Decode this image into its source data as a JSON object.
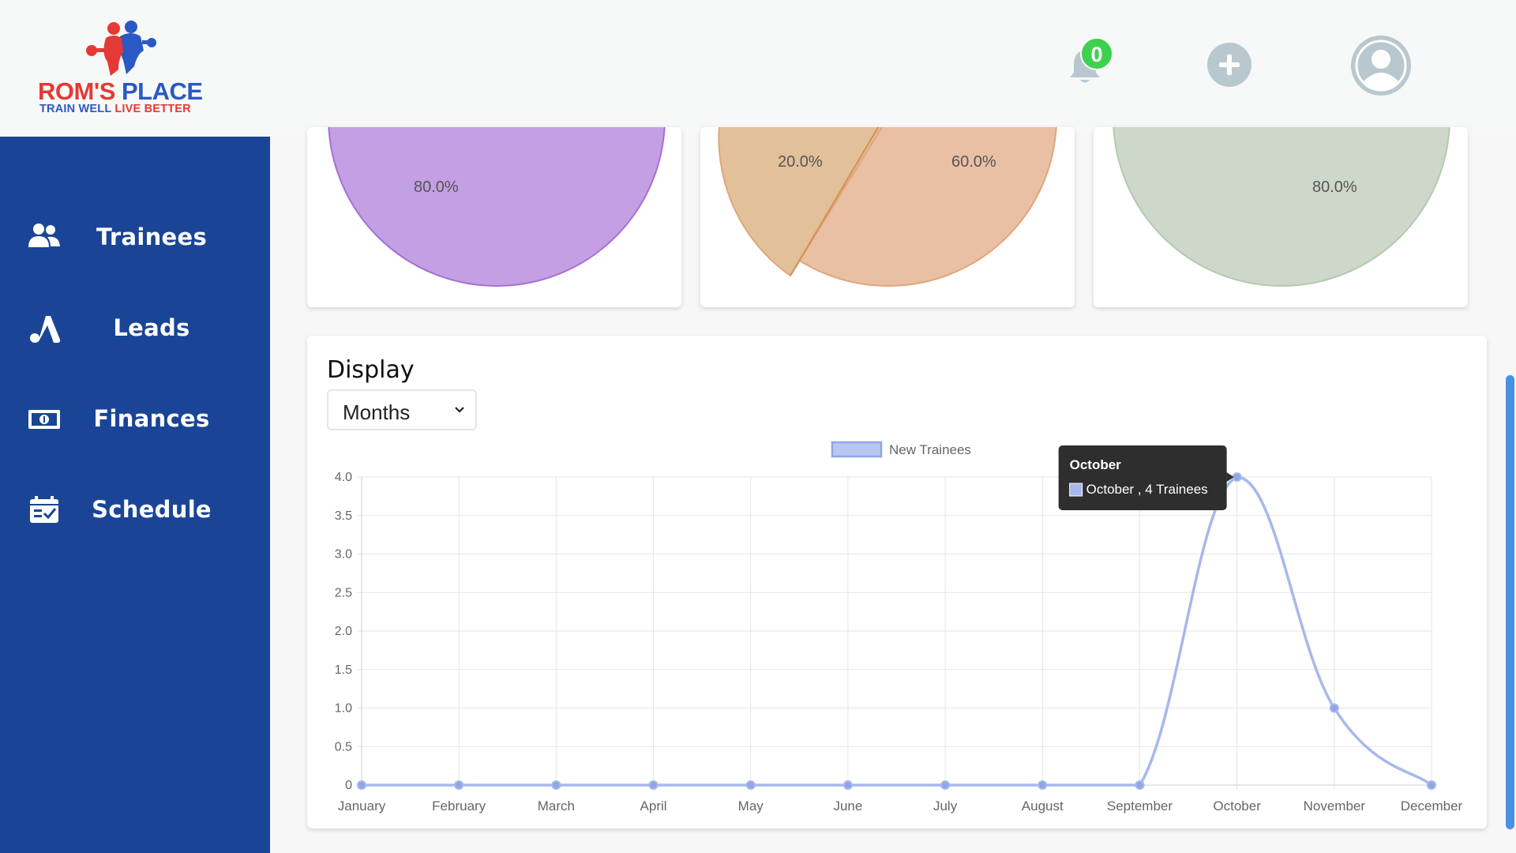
{
  "brand": {
    "name_part1": "ROM'S",
    "name_part2": "PLACE",
    "tagline_part1": "TRAIN WELL",
    "tagline_part2": "LIVE BETTER"
  },
  "header": {
    "notification_count": "0",
    "icons": [
      "bell-icon",
      "plus-icon",
      "user-avatar-icon"
    ]
  },
  "sidebar": {
    "items": [
      {
        "label": "Trainees",
        "icon": "users-icon"
      },
      {
        "label": "Leads",
        "icon": "leads-icon"
      },
      {
        "label": "Finances",
        "icon": "money-icon"
      },
      {
        "label": "Schedule",
        "icon": "calendar-check-icon"
      }
    ]
  },
  "pies": [
    {
      "labels": [
        "80.0%"
      ],
      "color": "#c39fe3",
      "border": "#a76fd6"
    },
    {
      "labels": [
        "20.0%",
        "60.0%"
      ],
      "colors": [
        "#e2c09a",
        "#eac0a4"
      ],
      "border": "#e0a67a"
    },
    {
      "labels": [
        "80.0%"
      ],
      "color": "#cdd8cb",
      "border": "#b4c9b2"
    }
  ],
  "display": {
    "title": "Display",
    "selected": "Months"
  },
  "chart_data": {
    "type": "line",
    "categories": [
      "January",
      "February",
      "March",
      "April",
      "May",
      "June",
      "July",
      "August",
      "September",
      "October",
      "November",
      "December"
    ],
    "series": [
      {
        "name": "New Trainees",
        "values": [
          0,
          0,
          0,
          0,
          0,
          0,
          0,
          0,
          0,
          4,
          1,
          0
        ],
        "color": "#a7b8ec"
      }
    ],
    "ylim": [
      0,
      4
    ],
    "yticks": [
      "0",
      "0.5",
      "1.0",
      "1.5",
      "2.0",
      "2.5",
      "3.0",
      "3.5",
      "4.0"
    ],
    "grid": true,
    "legend": "top",
    "tooltip": {
      "title": "October",
      "body": "October , 4 Trainees"
    }
  }
}
